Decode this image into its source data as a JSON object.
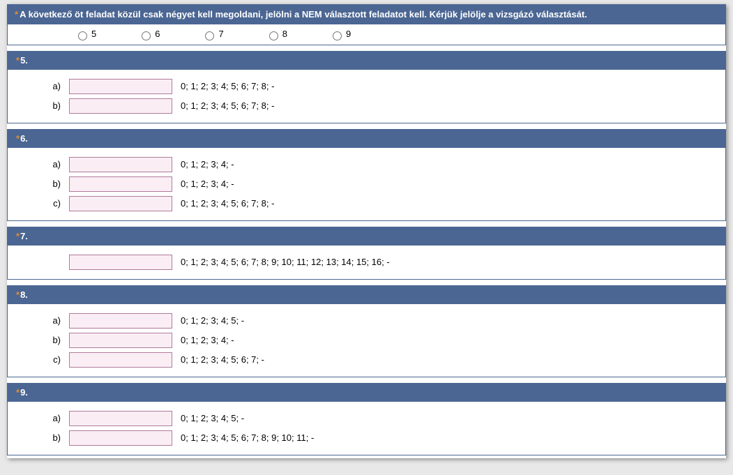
{
  "intro": {
    "text": "A következő öt feladat közül csak négyet kell megoldani, jelölni a NEM választott feladatot kell. Kérjük jelölje a vizsgázó választását."
  },
  "radios": [
    "5",
    "6",
    "7",
    "8",
    "9"
  ],
  "blocks": [
    {
      "id": "5",
      "title": "5.",
      "rows": [
        {
          "label": "a)",
          "hint": "0; 1; 2; 3; 4; 5; 6; 7; 8; -"
        },
        {
          "label": "b)",
          "hint": "0; 1; 2; 3; 4; 5; 6; 7; 8; -"
        }
      ]
    },
    {
      "id": "6",
      "title": "6.",
      "rows": [
        {
          "label": "a)",
          "hint": "0; 1; 2; 3; 4; -"
        },
        {
          "label": "b)",
          "hint": "0; 1; 2; 3; 4; -"
        },
        {
          "label": "c)",
          "hint": "0; 1; 2; 3; 4; 5; 6; 7; 8; -"
        }
      ]
    },
    {
      "id": "7",
      "title": "7.",
      "rows": [
        {
          "label": "",
          "hint": "0; 1; 2; 3; 4; 5; 6; 7; 8; 9; 10; 11; 12; 13; 14; 15; 16; -"
        }
      ]
    },
    {
      "id": "8",
      "title": "8.",
      "rows": [
        {
          "label": "a)",
          "hint": "0; 1; 2; 3; 4; 5; -"
        },
        {
          "label": "b)",
          "hint": "0; 1; 2; 3; 4; -"
        },
        {
          "label": "c)",
          "hint": "0; 1; 2; 3; 4; 5; 6; 7; -"
        }
      ]
    },
    {
      "id": "9",
      "title": "9.",
      "rows": [
        {
          "label": "a)",
          "hint": "0; 1; 2; 3; 4; 5; -"
        },
        {
          "label": "b)",
          "hint": "0; 1; 2; 3; 4; 5; 6; 7; 8; 9; 10; 11; -"
        }
      ]
    }
  ]
}
